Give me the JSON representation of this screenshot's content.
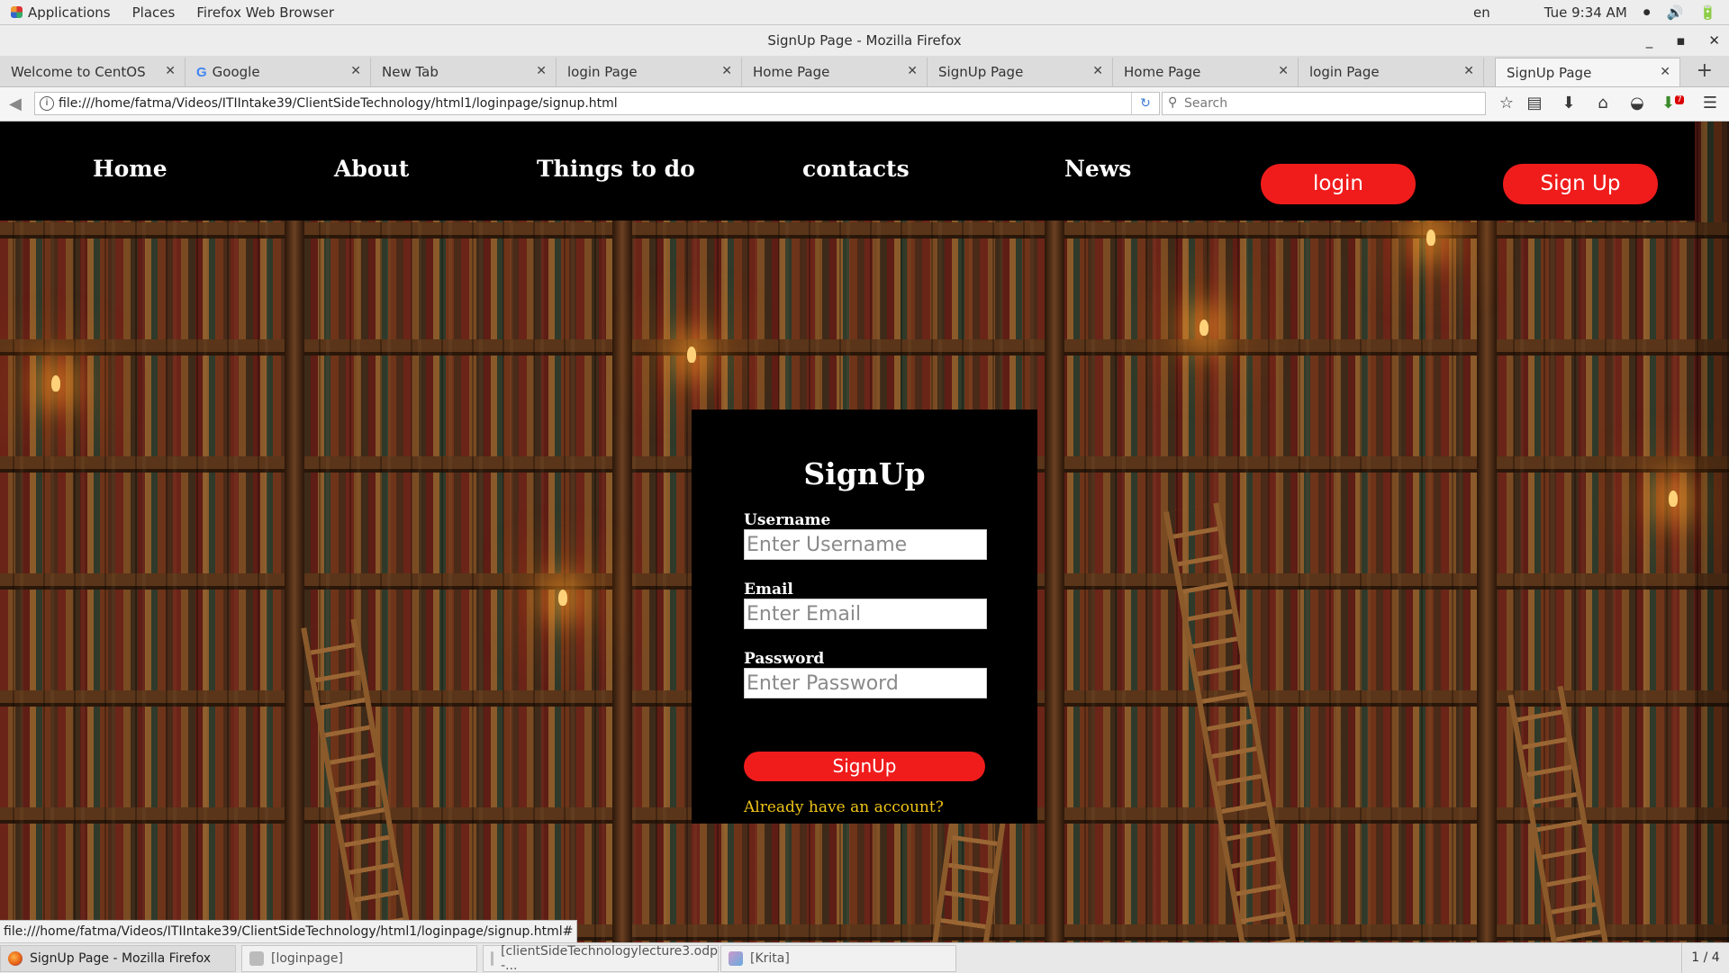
{
  "system_bar": {
    "applications": "Applications",
    "places": "Places",
    "browser": "Firefox Web Browser",
    "lang": "en",
    "clock": "Tue  9:34 AM"
  },
  "window": {
    "title": "SignUp Page - Mozilla Firefox"
  },
  "tabs": [
    {
      "label": "Welcome to CentOS"
    },
    {
      "label": "Google"
    },
    {
      "label": "New Tab"
    },
    {
      "label": "login Page"
    },
    {
      "label": "Home Page"
    },
    {
      "label": "SignUp Page"
    },
    {
      "label": "Home Page"
    },
    {
      "label": "login Page"
    },
    {
      "label": "SignUp Page"
    }
  ],
  "favicon_google": "G",
  "navbar": {
    "url": "file:///home/fatma/Videos/ITIIntake39/ClientSideTechnology/html1/loginpage/signup.html",
    "search_placeholder": "Search"
  },
  "site_nav": {
    "links": [
      "Home",
      "About",
      "Things to do",
      "contacts",
      "News"
    ],
    "login_label": "login",
    "signup_label": "Sign Up"
  },
  "signup_form": {
    "title": "SignUp",
    "username_label": "Username",
    "username_placeholder": "Enter Username",
    "email_label": "Email",
    "email_placeholder": "Enter Email",
    "password_label": "Password",
    "password_placeholder": "Enter Password",
    "submit_label": "SignUp",
    "login_link": "Already have an account?"
  },
  "status_url": "file:///home/fatma/Videos/ITIIntake39/ClientSideTechnology/html1/loginpage/signup.html#",
  "taskbar": {
    "items": [
      {
        "label": "SignUp Page - Mozilla Firefox"
      },
      {
        "label": "[loginpage]"
      },
      {
        "label": "[clientSideTechnologylecture3.odp -..."
      },
      {
        "label": "[Krita]"
      }
    ],
    "workspace": "1 / 4"
  },
  "notification_badge": "7",
  "colors": {
    "accent_red": "#f01c1c",
    "link_yellow": "#f0c419",
    "nav_bg": "#000000"
  },
  "icons": [
    "app-menu-icon",
    "volume-icon",
    "battery-icon",
    "minimize-icon",
    "maximize-icon",
    "close-icon",
    "back-icon",
    "info-icon",
    "reload-icon",
    "search-icon",
    "bookmark-star-icon",
    "reading-list-icon",
    "download-icon",
    "home-icon",
    "pocket-icon",
    "addon-icon",
    "hamburger-menu-icon"
  ]
}
